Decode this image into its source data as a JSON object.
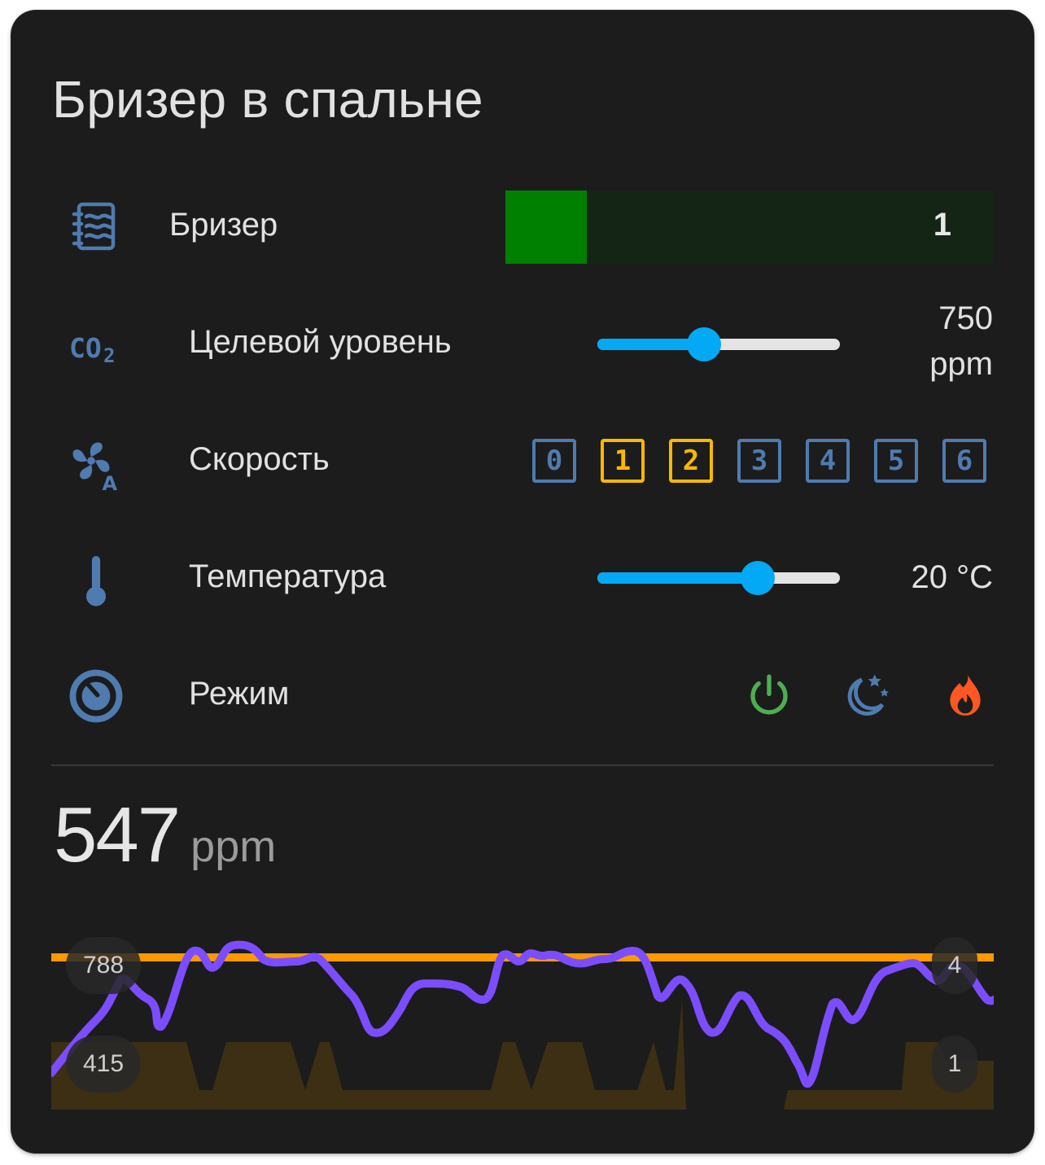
{
  "card": {
    "title": "Бризер в спальне"
  },
  "rows": {
    "breezer": {
      "label": "Бризер",
      "value": "1",
      "level_fraction": 0.167,
      "fill_color": "#008000",
      "icon": "air-filter-icon"
    },
    "target": {
      "label": "Целевой уровень",
      "value": "750",
      "unit": "ppm",
      "slider_fraction": 0.44,
      "icon": "co2-icon"
    },
    "speed": {
      "label": "Скорость",
      "options": [
        "0",
        "1",
        "2",
        "3",
        "4",
        "5",
        "6"
      ],
      "active": [
        "1",
        "2"
      ],
      "active_color": "#fbb800",
      "inactive_color": "#4f7bb0",
      "icon": "fan-auto-icon"
    },
    "temperature": {
      "label": "Температура",
      "value": "20 °C",
      "slider_fraction": 0.66,
      "icon": "thermometer-icon"
    },
    "mode": {
      "label": "Режим",
      "icon": "gauge-icon",
      "buttons": [
        {
          "name": "power",
          "color": "#4caf50",
          "icon": "power-icon"
        },
        {
          "name": "night",
          "color": "#4f7bb0",
          "icon": "moon-stars-icon"
        },
        {
          "name": "boost",
          "color": "#ff5722",
          "icon": "fire-icon"
        }
      ]
    }
  },
  "sensor": {
    "value": "547",
    "unit": "ppm",
    "axis_left": {
      "max": "788",
      "min": "415"
    },
    "axis_right": {
      "max": "4",
      "min": "1"
    },
    "line_color": "#7c4dff",
    "threshold_color": "#ff9800",
    "bars_color": "#3d2f14"
  }
}
